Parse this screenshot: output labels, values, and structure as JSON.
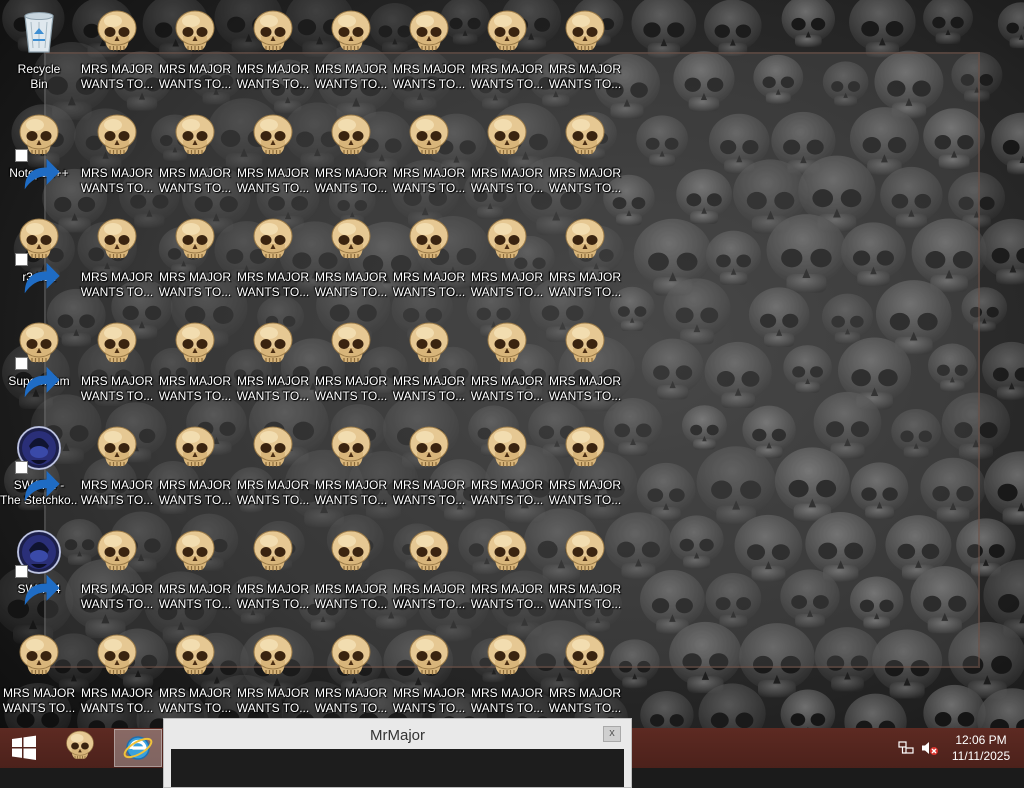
{
  "desktop": {
    "left_column": [
      {
        "label": "Recycle Bin",
        "icon": "recycle-bin-icon",
        "shortcut": false
      },
      {
        "label": "Notepad++",
        "icon": "skull-icon",
        "shortcut": true
      },
      {
        "label": "r3dfox",
        "icon": "skull-icon",
        "shortcut": true
      },
      {
        "label": "Supermium",
        "icon": "skull-icon",
        "shortcut": true
      },
      {
        "label": "SWAT 4 - The Stetchkov S...",
        "icon": "swat-badge-icon",
        "shortcut": true
      },
      {
        "label": "SWAT 4",
        "icon": "swat-badge-icon",
        "shortcut": true
      },
      {
        "label": "MRS MAJOR WANTS TO...",
        "icon": "skull-icon",
        "shortcut": false
      }
    ],
    "repeated_icon": {
      "label": "MRS MAJOR WANTS TO...",
      "icon": "skull-icon",
      "columns": 7,
      "rows": 7
    }
  },
  "dialog": {
    "title": "MrMajor",
    "close_label": "x"
  },
  "taskbar": {
    "start_icon": "windows-logo-icon",
    "pinned": [
      {
        "name": "skull-app",
        "icon": "skull-icon"
      },
      {
        "name": "internet-explorer",
        "icon": "internet-explorer-icon",
        "active": true
      }
    ],
    "tray": {
      "network_icon": "network-icon",
      "volume_icon": "volume-muted-icon",
      "time": "12:06 PM",
      "date": "11/11/2025"
    }
  },
  "colors": {
    "taskbar": "#4f231c",
    "label_text": "#ffffff",
    "skull_bone": "#e3c48e"
  }
}
